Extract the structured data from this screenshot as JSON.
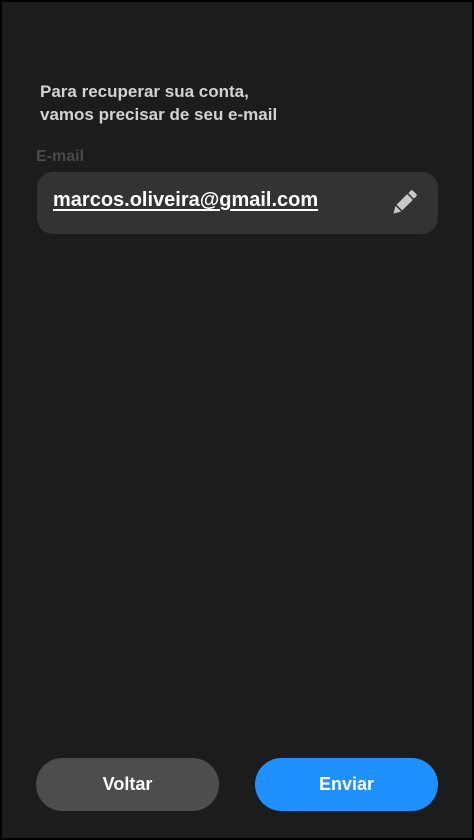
{
  "intro": {
    "line1": "Para recuperar sua conta,",
    "line2": "vamos precisar de seu e-mail"
  },
  "email": {
    "label": "E-mail",
    "value": "marcos.oliveira@gmail.com",
    "edit_icon": "pencil-icon"
  },
  "actions": {
    "back_label": "Voltar",
    "send_label": "Enviar"
  },
  "colors": {
    "background": "#1c1c1c",
    "field": "#333333",
    "back_button": "#4d4d4d",
    "send_button": "#1e90ff"
  }
}
